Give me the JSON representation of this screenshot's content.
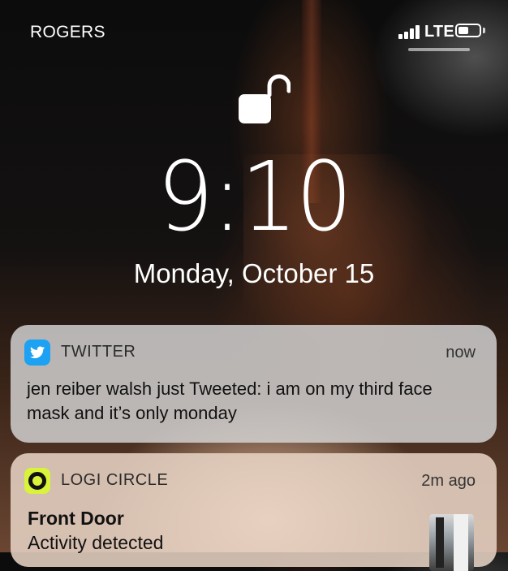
{
  "status_bar": {
    "carrier": "ROGERS",
    "network": "LTE",
    "signal_icon": "signal-bars-icon",
    "battery_icon": "battery-icon"
  },
  "lock_screen": {
    "lock_icon": "unlock-icon",
    "time": "9:10",
    "date": "Monday, October 15"
  },
  "notifications": [
    {
      "app": "TWITTER",
      "icon": "twitter-icon",
      "time": "now",
      "body": "jen reiber walsh just Tweeted: i am on my third face mask and it’s only monday",
      "accent": "#1DA1F2"
    },
    {
      "app": "LOGI CIRCLE",
      "icon": "logi-circle-icon",
      "time": "2m ago",
      "title": "Front Door",
      "body": "Activity detected",
      "accent": "#D9F23A"
    }
  ]
}
